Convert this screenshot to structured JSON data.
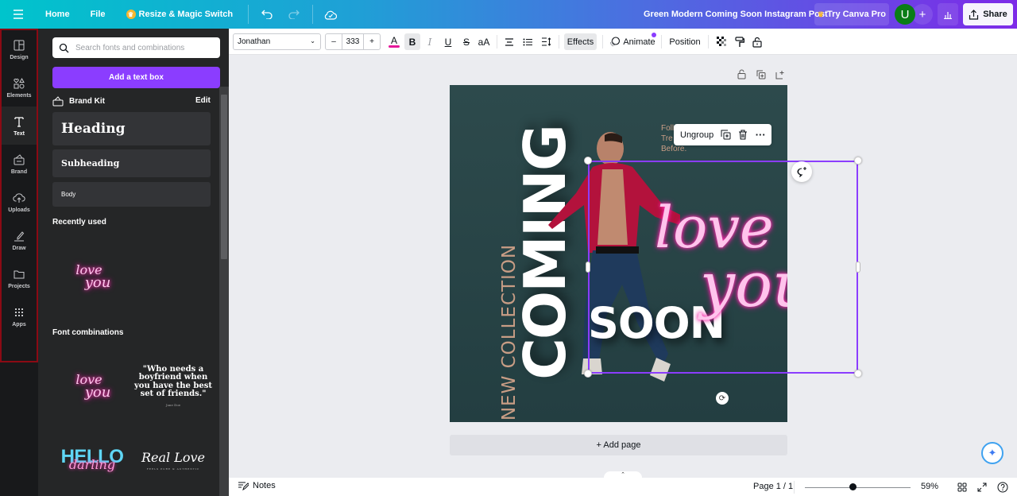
{
  "topbar": {
    "menu_icon": "hamburger-icon",
    "home": "Home",
    "file": "File",
    "resize": "Resize & Magic Switch",
    "doc_title": "Green Modern Coming Soon Instagram Post",
    "try_pro": "Try Canva Pro",
    "avatar_initial": "U",
    "share": "Share"
  },
  "rail": {
    "items": [
      {
        "label": "Design",
        "icon": "layout-icon"
      },
      {
        "label": "Elements",
        "icon": "shapes-icon"
      },
      {
        "label": "Text",
        "icon": "text-icon",
        "active": true
      },
      {
        "label": "Brand",
        "icon": "brand-icon"
      },
      {
        "label": "Uploads",
        "icon": "cloud-upload-icon"
      },
      {
        "label": "Draw",
        "icon": "pen-icon"
      },
      {
        "label": "Projects",
        "icon": "folder-icon"
      },
      {
        "label": "Apps",
        "icon": "grid-icon"
      }
    ]
  },
  "panel": {
    "search_placeholder": "Search fonts and combinations",
    "add_text_box": "Add a text box",
    "brand_kit": "Brand Kit",
    "edit": "Edit",
    "heading": "Heading",
    "subheading": "Subheading",
    "body": "Body",
    "recently_used": "Recently used",
    "recent_love": "love",
    "recent_you": "you",
    "font_combinations": "Font combinations",
    "combo_love": "love",
    "combo_you": "you",
    "combo_quote": "\"Who needs a boyfriend when you have the best set of friends.\"",
    "combo_quote_author": "Jane Doe",
    "combo_hello": "HELLO",
    "combo_darling": "darling",
    "combo_real_love": "Real Love",
    "combo_real_love_sub": "FEELS PURE & AUTHENTIC"
  },
  "toolbar": {
    "font": "Jonathan",
    "font_size": "333",
    "minus": "–",
    "plus": "+",
    "text_color": "#e5199a",
    "effects": "Effects",
    "animate": "Animate",
    "position": "Position"
  },
  "design": {
    "new_collection": "NEW COLLECTION",
    "coming": "COMING",
    "soon": "SOON",
    "love": "love",
    "you": "you",
    "tagline_1": "Foll",
    "tagline_2": "Tre",
    "tagline_3": "Before."
  },
  "context_menu": {
    "ungroup": "Ungroup"
  },
  "canvas": {
    "add_page": "+ Add page"
  },
  "footer": {
    "notes": "Notes",
    "page_indicator": "Page 1 / 1",
    "zoom_percent": "59%",
    "zoom_value": 59
  },
  "colors": {
    "accent": "#8b3dff",
    "design_bg": "#2d4a4c",
    "neon_pink": "#ff3cb4",
    "tan": "#c89d85"
  }
}
